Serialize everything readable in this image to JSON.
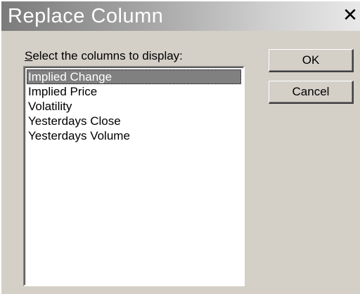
{
  "window": {
    "title": "Replace Column",
    "close_glyph": "✕"
  },
  "prompt": {
    "accel": "S",
    "rest": "elect the columns to display:"
  },
  "list": {
    "items": [
      "Implied Change",
      "Implied Price",
      "Volatility",
      "Yesterdays Close",
      "Yesterdays Volume"
    ],
    "selected": "Implied Change"
  },
  "buttons": {
    "ok": "OK",
    "cancel": "Cancel"
  },
  "colors": {
    "face": "#d4d0c8",
    "selection": "#808080"
  }
}
